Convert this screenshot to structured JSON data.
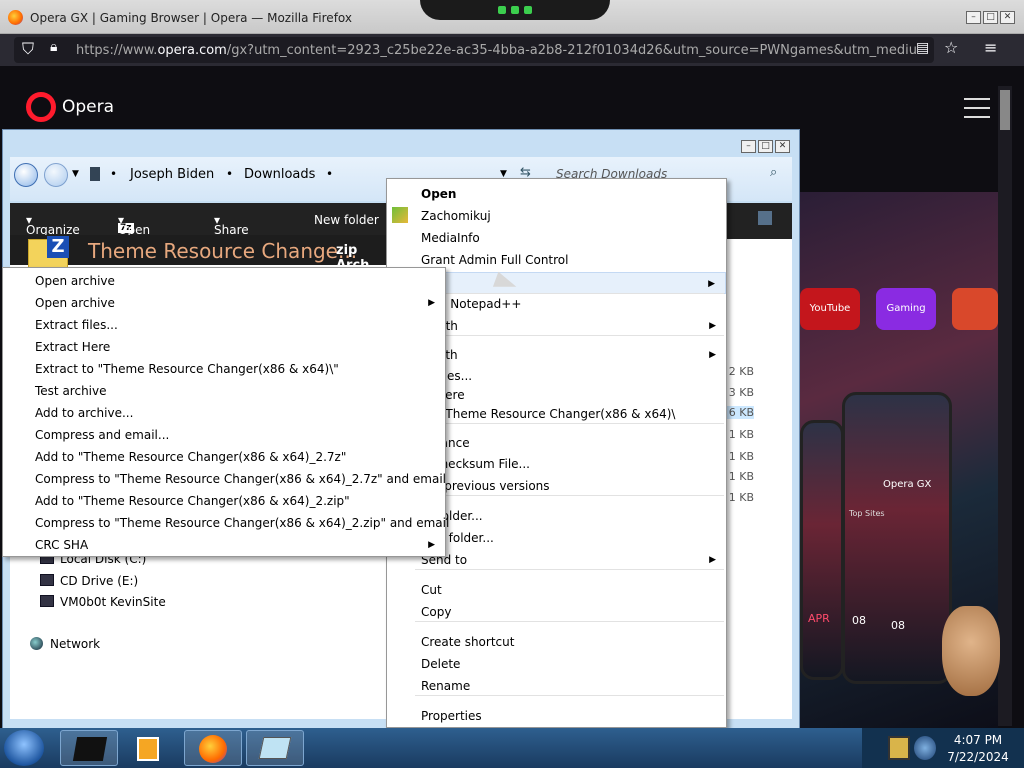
{
  "firefox": {
    "title": "Opera GX | Gaming Browser | Opera — Mozilla Firefox",
    "url_prefix": "https://www.",
    "url_domain": "opera.com",
    "url_rest": "/gx?utm_content=2923_c25be22e-ac35-4bba-a2b8-212f01034d26&utm_source=PWNgames&utm_medium=pa"
  },
  "opera": {
    "logo_text": "Opera"
  },
  "promo": {
    "youtube": "YouTube",
    "gaming": "Gaming",
    "phone_brand": "Opera GX",
    "top_sites": "Top Sites",
    "time_left": "08",
    "time_right": "08",
    "month": "APR",
    "day": "08"
  },
  "explorer": {
    "breadcrumb": [
      "Joseph Biden",
      "Downloads"
    ],
    "search_placeholder": "Search Downloads",
    "toolbar": {
      "organize": "Organize",
      "open": "Open",
      "share_with": "Share with",
      "new_folder": "New folder"
    },
    "selected_file": "Theme Resource Change...",
    "selected_type": "zip Arch",
    "tree": [
      "Local Disk (C:)",
      "CD Drive (E:)",
      "VM0b0t KevinSite"
    ],
    "network": "Network",
    "sizes": [
      "2 KB",
      "3 KB",
      "6 KB",
      "1 KB",
      "1 KB",
      "1 KB",
      "1 KB"
    ]
  },
  "menu_main": {
    "items": [
      {
        "label": "Open",
        "bold": true
      },
      {
        "label": "Zachomikuj"
      },
      {
        "label": "MediaInfo"
      },
      {
        "label": "Grant Admin Full Control"
      },
      {
        "label": "",
        "submenu": true
      },
      {
        "label": "with Notepad++"
      },
      {
        "label": "n with",
        "submenu": true
      },
      {
        "label": "e with",
        "submenu": true
      },
      {
        "label": "ct files..."
      },
      {
        "label": "ct Here"
      },
      {
        "label": "t to Theme Resource Changer(x86 & x64)\\"
      },
      {
        "label": "earance"
      },
      {
        "label": "e Checksum File..."
      },
      {
        "label": "ore previous versions"
      },
      {
        "label": "To folder..."
      },
      {
        "label": "e To folder..."
      },
      {
        "label": "Send to",
        "submenu": true
      },
      {
        "label": "Cut"
      },
      {
        "label": "Copy"
      },
      {
        "label": "Create shortcut"
      },
      {
        "label": "Delete"
      },
      {
        "label": "Rename"
      },
      {
        "label": "Properties"
      }
    ]
  },
  "menu_7zip": {
    "items": [
      {
        "label": "Open archive"
      },
      {
        "label": "Open archive",
        "submenu": true
      },
      {
        "label": "Extract files..."
      },
      {
        "label": "Extract Here"
      },
      {
        "label": "Extract to \"Theme Resource Changer(x86 & x64)\\\""
      },
      {
        "label": "Test archive"
      },
      {
        "label": "Add to archive..."
      },
      {
        "label": "Compress and email..."
      },
      {
        "label": "Add to \"Theme Resource Changer(x86 & x64)_2.7z\""
      },
      {
        "label": "Compress to \"Theme Resource Changer(x86 & x64)_2.7z\" and email"
      },
      {
        "label": "Add to \"Theme Resource Changer(x86 & x64)_2.zip\""
      },
      {
        "label": "Compress to \"Theme Resource Changer(x86 & x64)_2.zip\" and email"
      },
      {
        "label": "CRC SHA",
        "submenu": true
      }
    ]
  },
  "taskbar": {
    "time": "4:07 PM",
    "date": "7/22/2024"
  },
  "colors": {
    "opera_red": "#ff1b2d",
    "firefox_dark": "#2b2a33",
    "taskbar_blue": "#1a3b60"
  }
}
